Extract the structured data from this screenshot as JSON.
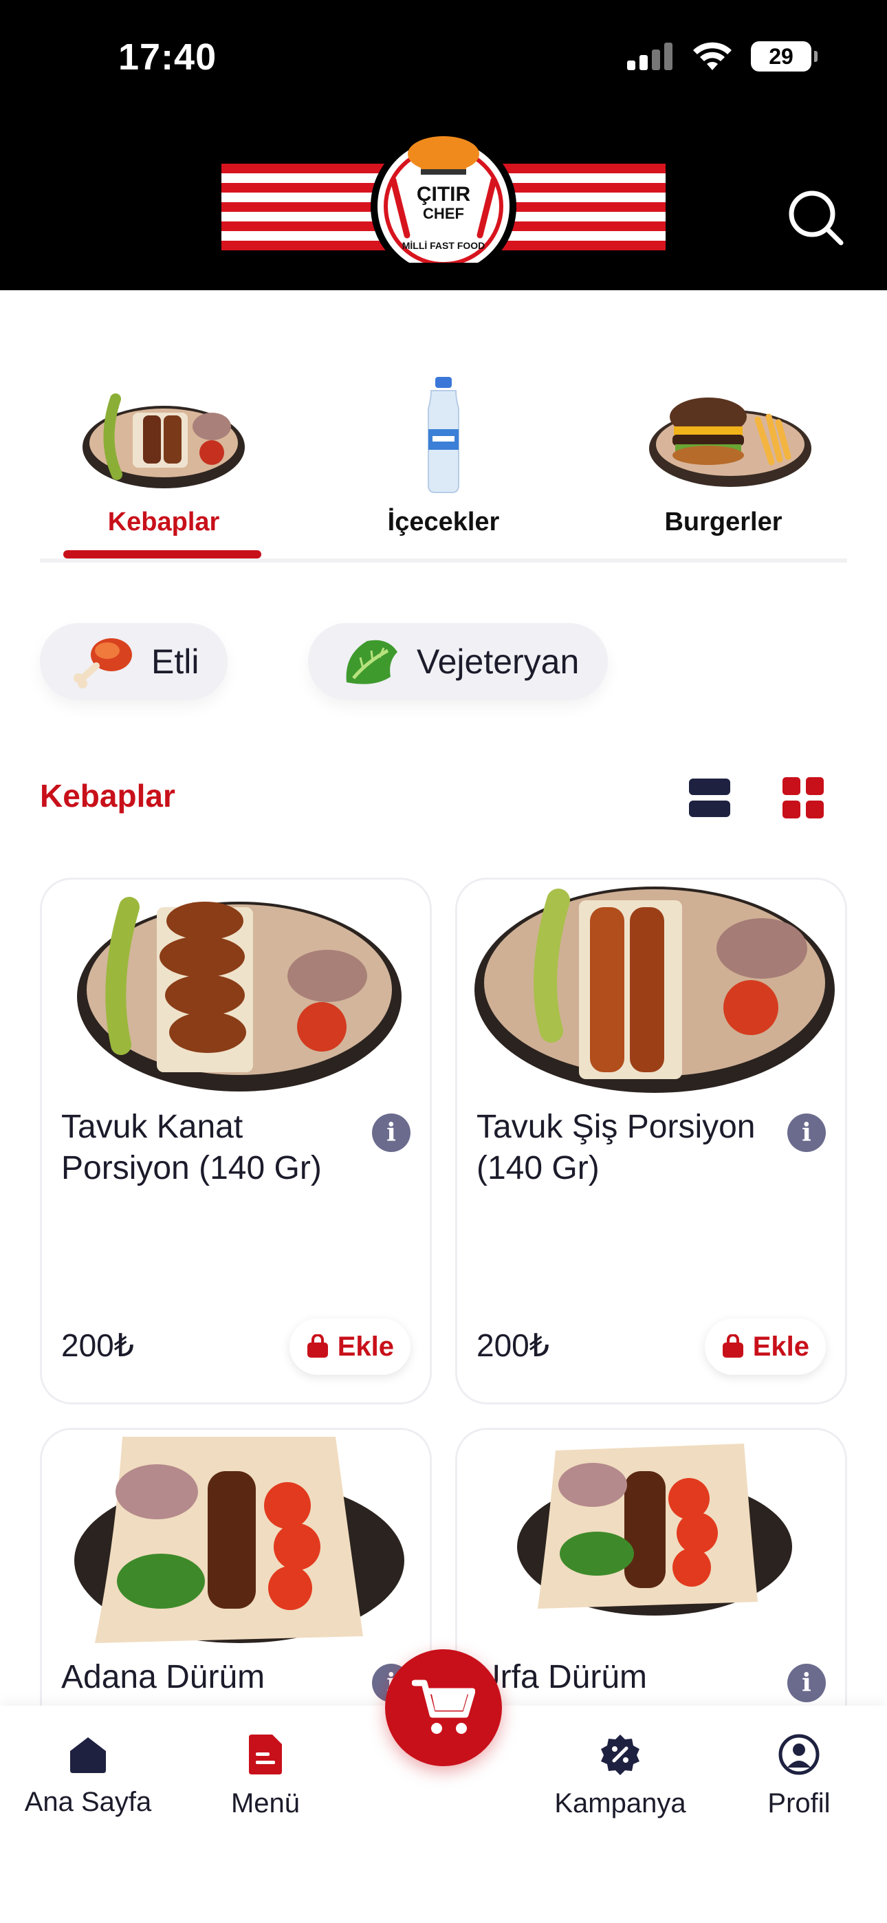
{
  "status_bar": {
    "time": "17:40",
    "battery": "29"
  },
  "header": {
    "logo_text_1": "ÇITIR",
    "logo_text_2": "CHEF",
    "logo_text_3": "MİLLİ FAST FOOD"
  },
  "categories": [
    {
      "label": "Kebaplar",
      "active": true
    },
    {
      "label": "İçecekler",
      "active": false
    },
    {
      "label": "Burgerler",
      "active": false
    }
  ],
  "filters": [
    {
      "label": "Etli"
    },
    {
      "label": "Vejeteryan"
    }
  ],
  "section": {
    "title": "Kebaplar"
  },
  "products": [
    {
      "name": "Tavuk Kanat Porsiyon (140 Gr)",
      "price": "200₺",
      "add_label": "Ekle"
    },
    {
      "name": "Tavuk Şiş Porsiyon (140 Gr)",
      "price": "200₺",
      "add_label": "Ekle"
    },
    {
      "name": "Adana Dürüm",
      "price": "",
      "add_label": ""
    },
    {
      "name": "Urfa Dürüm",
      "price": "",
      "add_label": ""
    }
  ],
  "bottom_nav": [
    {
      "label": "Ana Sayfa",
      "icon": "home-icon"
    },
    {
      "label": "Menü",
      "icon": "menu-icon"
    },
    {
      "label": "Kampanya",
      "icon": "discount-icon"
    },
    {
      "label": "Profil",
      "icon": "profile-icon"
    }
  ],
  "colors": {
    "brand_red": "#c8101a",
    "ink": "#1b1b2b",
    "chip_bg": "#f0f0f5"
  }
}
